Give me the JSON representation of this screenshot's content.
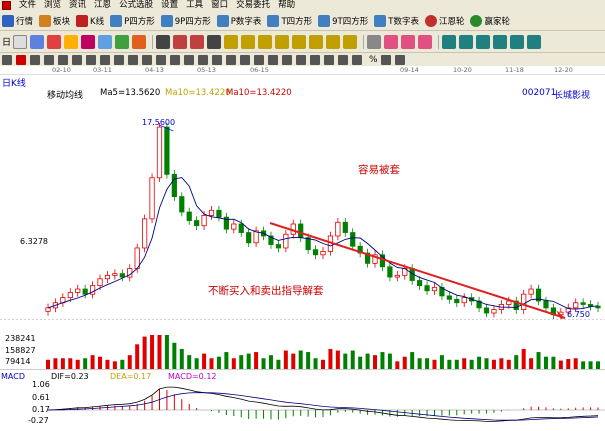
{
  "menu": [
    "文件",
    "浏览",
    "资讯",
    "江恩",
    "公式选股",
    "设置",
    "工具",
    "窗口",
    "交易委托",
    "帮助"
  ],
  "toolbar1": [
    "行情",
    "板块",
    "K线",
    "P四方形",
    "9P四方形",
    "P数字表",
    "T四方形",
    "9T四方形",
    "T数字表",
    "江恩轮",
    "赢家轮"
  ],
  "toolbar2": {
    "day_label": "日"
  },
  "toolbar3": {
    "percent": "%"
  },
  "date_axis": [
    "02-10",
    "03-11",
    "04-13",
    "05-13",
    "06-15",
    "09-14",
    "10-20",
    "11-18",
    "12-20"
  ],
  "chart_header": {
    "period": "日K线",
    "ma_title": "移动均线",
    "ma5": "Ma5=13.5620",
    "ma10_a": "Ma10=13.4220",
    "ma10_b": "Ma10=13.4220",
    "stock_code": "002071",
    "stock_name": "长城影视"
  },
  "price_labels": {
    "high": "17.5600",
    "mid": "6.3278",
    "low": "6.750"
  },
  "annotations": {
    "top": "容易被套",
    "bottom": "不断买入和卖出指导解套"
  },
  "volume_axis": [
    "238241",
    "158827",
    "79414"
  ],
  "macd": {
    "title": "MACD",
    "dif": "DIF=0.23",
    "dea": "DEA=0.17",
    "macd": "MACD=0.12",
    "axis": [
      "1.06",
      "0.61",
      "0.17",
      "-0.27"
    ]
  },
  "colors": {
    "up": "#e00000",
    "down": "#008000",
    "ma": "#000080",
    "trend": "#e02020",
    "chrome": "#ece9d8"
  },
  "chart_data": {
    "type": "candlestick",
    "price_series": [
      7.0,
      7.3,
      7.6,
      7.9,
      8.1,
      7.8,
      8.3,
      8.7,
      8.9,
      9.0,
      8.8,
      9.3,
      10.5,
      12.2,
      14.6,
      17.56,
      14.8,
      13.5,
      12.6,
      12.1,
      11.8,
      12.4,
      12.7,
      12.3,
      11.6,
      11.9,
      11.4,
      10.8,
      11.5,
      11.2,
      10.7,
      10.5,
      11.3,
      11.9,
      11.1,
      10.4,
      10.1,
      10.3,
      11.2,
      12.0,
      11.4,
      10.6,
      10.2,
      9.6,
      10.1,
      9.4,
      8.8,
      8.9,
      9.3,
      8.6,
      8.3,
      8.0,
      8.2,
      7.7,
      7.5,
      7.3,
      7.6,
      7.4,
      7.0,
      6.7,
      6.9,
      7.2,
      7.4,
      6.9,
      7.8,
      8.1,
      7.4,
      7.0,
      6.6,
      6.75,
      7.0,
      7.3,
      7.2,
      7.1,
      7.0
    ],
    "ylim": [
      6.0,
      18.5
    ]
  }
}
